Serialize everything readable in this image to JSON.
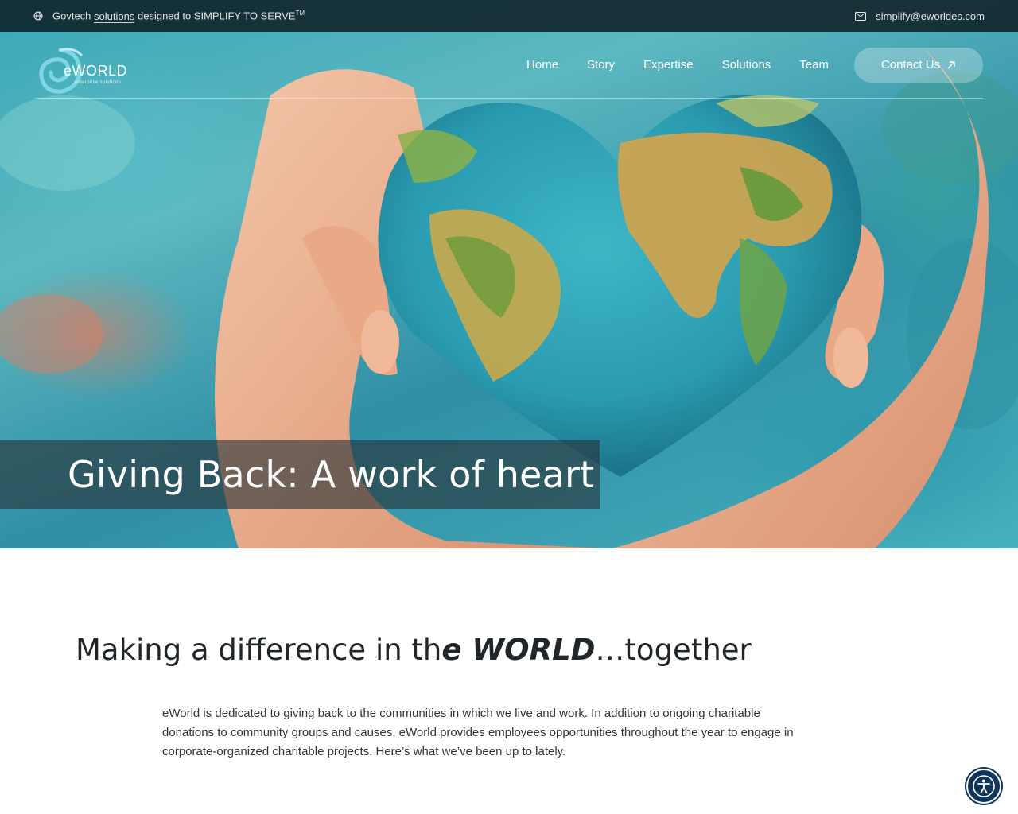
{
  "topbar": {
    "tagline_prefix": "Govtech",
    "tagline_link": "solutions",
    "tagline_suffix": "designed to SIMPLIFY TO SERVE",
    "trademark": "TM",
    "email": "simplify@eworldes.com",
    "icons": {
      "left": "globe-icon",
      "right": "mail-icon"
    }
  },
  "logo": {
    "word": "eWORLD",
    "subtitle": "enterprise solutions"
  },
  "nav": {
    "items": [
      {
        "label": "Home"
      },
      {
        "label": "Story"
      },
      {
        "label": "Expertise"
      },
      {
        "label": "Solutions"
      },
      {
        "label": "Team"
      }
    ],
    "contact_label": "Contact Us",
    "contact_icon": "arrow-up-right-icon"
  },
  "hero": {
    "title": "Giving Back: A work of heart"
  },
  "content": {
    "headline_part1": "Making a difference in th",
    "headline_emph": "e WORLD",
    "headline_part2": "…together",
    "body": "eWorld is dedicated to giving back to the communities in which we live and work. In addition to ongoing charitable donations to community groups and causes, eWorld provides employees opportunities throughout the year to engage in corporate-organized charitable projects.  Here’s what we’ve been up to lately."
  },
  "accessibility": {
    "icon": "accessibility-icon"
  },
  "colors": {
    "topbar_bg": "#0a161c",
    "headline": "#1f2529",
    "a11y": "#10355a",
    "logo_teal": "#7fd6e0"
  }
}
